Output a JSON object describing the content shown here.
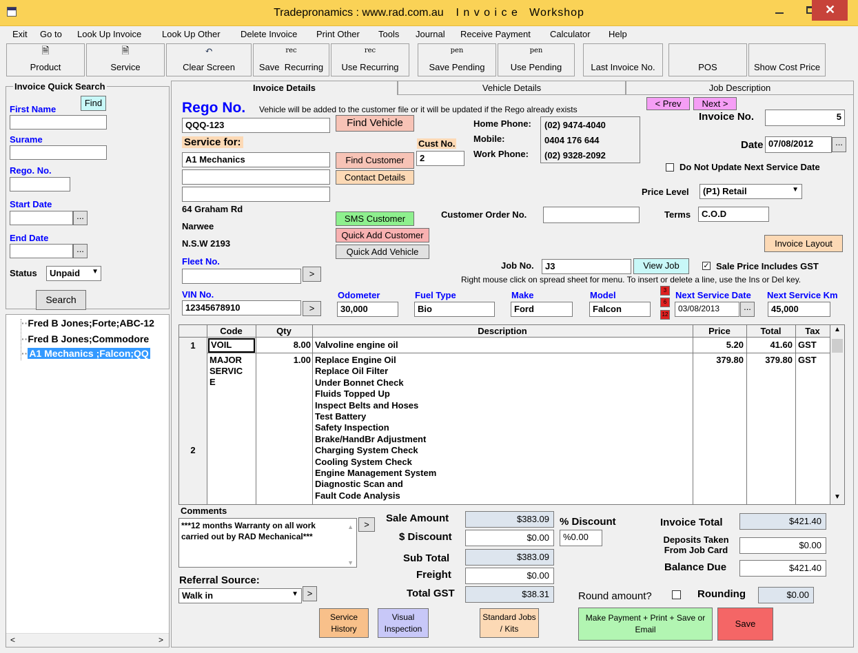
{
  "window": {
    "title_left": "Tradepronamics :  www.rad.com.au",
    "title_right": "I n v o i c e   Workshop"
  },
  "menu": [
    "Exit",
    "Go to",
    "Look Up Invoice",
    "Look Up Other",
    "Delete Invoice",
    "Print Other",
    "Tools",
    "Journal",
    "Receive Payment",
    "Calculator",
    "Help"
  ],
  "toolbar": [
    {
      "icon": "",
      "label": "Product"
    },
    {
      "icon": "",
      "label": "Service"
    },
    {
      "icon": "",
      "label": "Clear Screen"
    },
    {
      "icon": "rec",
      "label": "Save  Recurring"
    },
    {
      "icon": "rec",
      "label": "Use Recurring"
    },
    {
      "icon": "pen",
      "label": "Save Pending"
    },
    {
      "icon": "pen",
      "label": "Use Pending"
    },
    {
      "icon": "",
      "label": "Last Invoice No."
    },
    {
      "icon": "",
      "label": "POS"
    },
    {
      "icon": "",
      "label": "Show Cost Price"
    }
  ],
  "quick_search": {
    "title": "Invoice Quick Search",
    "find": "Find",
    "first_name": "First Name",
    "surname": "Surame",
    "rego": "Rego. No.",
    "start_date": "Start Date",
    "end_date": "End Date",
    "status_label": "Status",
    "status_value": "Unpaid",
    "search": "Search",
    "results": [
      "Fred B Jones;Forte;ABC-12",
      "Fred B Jones;Commodore",
      "A1 Mechanics  ;Falcon;QQ"
    ]
  },
  "tabs": [
    "Invoice Details",
    "Vehicle Details",
    "Job Description"
  ],
  "rego": {
    "title": "Rego No.",
    "note": "Vehicle will be added to the customer file or it will be updated if the Rego already exists",
    "value": "QQQ-123",
    "find_vehicle": "Find Vehicle"
  },
  "customer": {
    "service_for": "Service for:",
    "name": "A1 Mechanics",
    "find_customer": "Find Customer",
    "contact_details": "Contact Details",
    "cust_no_label": "Cust No.",
    "cust_no": "2",
    "address1": "64 Graham Rd",
    "address2": "Narwee",
    "address3": "N.S.W  2193",
    "sms": "SMS Customer",
    "quick_add_customer": "Quick Add Customer",
    "quick_add_vehicle": "Quick Add Vehicle",
    "fleet_label": "Fleet No.",
    "vin_label": "VIN No.",
    "vin": "12345678910"
  },
  "phones": {
    "home_label": "Home Phone:",
    "home": "(02) 9474-4040",
    "mobile_label": "Mobile:",
    "mobile": "0404 176 644",
    "work_label": "Work Phone:",
    "work": "(02) 9328-2092"
  },
  "nav": {
    "prev": "< Prev",
    "next": "Next >"
  },
  "invoice": {
    "no_label": "Invoice No.",
    "no": "5",
    "date_label": "Date",
    "date": "07/08/2012",
    "do_not_update": "Do Not Update Next Service Date",
    "price_level_label": "Price Level",
    "price_level": "(P1) Retail",
    "terms_label": "Terms",
    "terms": "C.O.D",
    "order_label": "Customer Order No.",
    "layout": "Invoice Layout",
    "job_label": "Job No.",
    "job": "J3",
    "view_job": "View Job",
    "sale_incl_gst": "Sale Price Includes GST",
    "hint": "Right mouse click on spread sheet for menu. To insert or delete a line, use the Ins or Del key."
  },
  "vehicle": {
    "odometer_label": "Odometer",
    "odometer": "30,000",
    "fuel_label": "Fuel Type",
    "fuel": "Bio",
    "make_label": "Make",
    "make": "Ford",
    "model_label": "Model",
    "model": "Falcon",
    "months": [
      "3",
      "6",
      "12"
    ],
    "next_date_label": "Next Service Date",
    "next_date": "03/08/2013",
    "next_km_label": "Next Service Km",
    "next_km": "45,000"
  },
  "grid": {
    "headers": [
      "Code",
      "Qty",
      "Description",
      "Price",
      "Total",
      "Tax"
    ],
    "rows": [
      {
        "num": "1",
        "code": "VOIL",
        "qty": "8.00",
        "desc": [
          "Valvoline engine oil"
        ],
        "price": "5.20",
        "total": "41.60",
        "tax": "GST"
      },
      {
        "num": "2",
        "code": "MAJOR SERVIC E",
        "qty": "1.00",
        "desc": [
          "Replace Engine Oil",
          "Replace Oil Filter",
          "Under Bonnet Check",
          "Fluids Topped Up",
          "Inspect Belts and Hoses",
          "Test Battery",
          "Safety Inspection",
          "Brake/HandBr Adjustment",
          "Charging System Check",
          "Cooling System Check",
          "Engine Management System",
          "Diagnostic Scan and",
          "Fault Code Analysis"
        ],
        "price": "379.80",
        "total": "379.80",
        "tax": "GST"
      }
    ]
  },
  "comments": {
    "label": "Comments",
    "text": "***12 months Warranty on all work carried out by RAD Mechanical***"
  },
  "referral": {
    "label": "Referral Source:",
    "value": "Walk in"
  },
  "totals": {
    "sale_amount_label": "Sale Amount",
    "sale_amount": "$383.09",
    "discount_label": "$ Discount",
    "discount": "$0.00",
    "pct_discount_label": "% Discount",
    "pct_discount": "%0.00",
    "subtotal_label": "Sub Total",
    "subtotal": "$383.09",
    "freight_label": "Freight",
    "freight": "$0.00",
    "gst_label": "Total GST",
    "gst": "$38.31",
    "invoice_total_label": "Invoice Total",
    "invoice_total": "$421.40",
    "deposits_label": "Deposits Taken From Job Card",
    "deposits": "$0.00",
    "balance_label": "Balance Due",
    "balance": "$421.40",
    "round_label": "Round amount?",
    "rounding_label": "Rounding",
    "rounding": "$0.00"
  },
  "bottom_buttons": {
    "service_history": "Service History",
    "visual_inspection": "Visual Inspection",
    "standard_jobs": "Standard Jobs / Kits",
    "make_payment": "Make Payment + Print + Save or Email",
    "save": "Save"
  },
  "colors": {
    "titlebar": "#fad256",
    "close": "#c7433a",
    "find_vehicle": "#f7c3b6",
    "sms": "#8ef08e",
    "quick_add": "#f8b1b1",
    "view_job": "#c8f8f8",
    "prev_next": "#f59ef5",
    "service_history": "#f8c08a",
    "visual": "#c8c8f8",
    "payment": "#b2f5b2",
    "save": "#f46666"
  }
}
